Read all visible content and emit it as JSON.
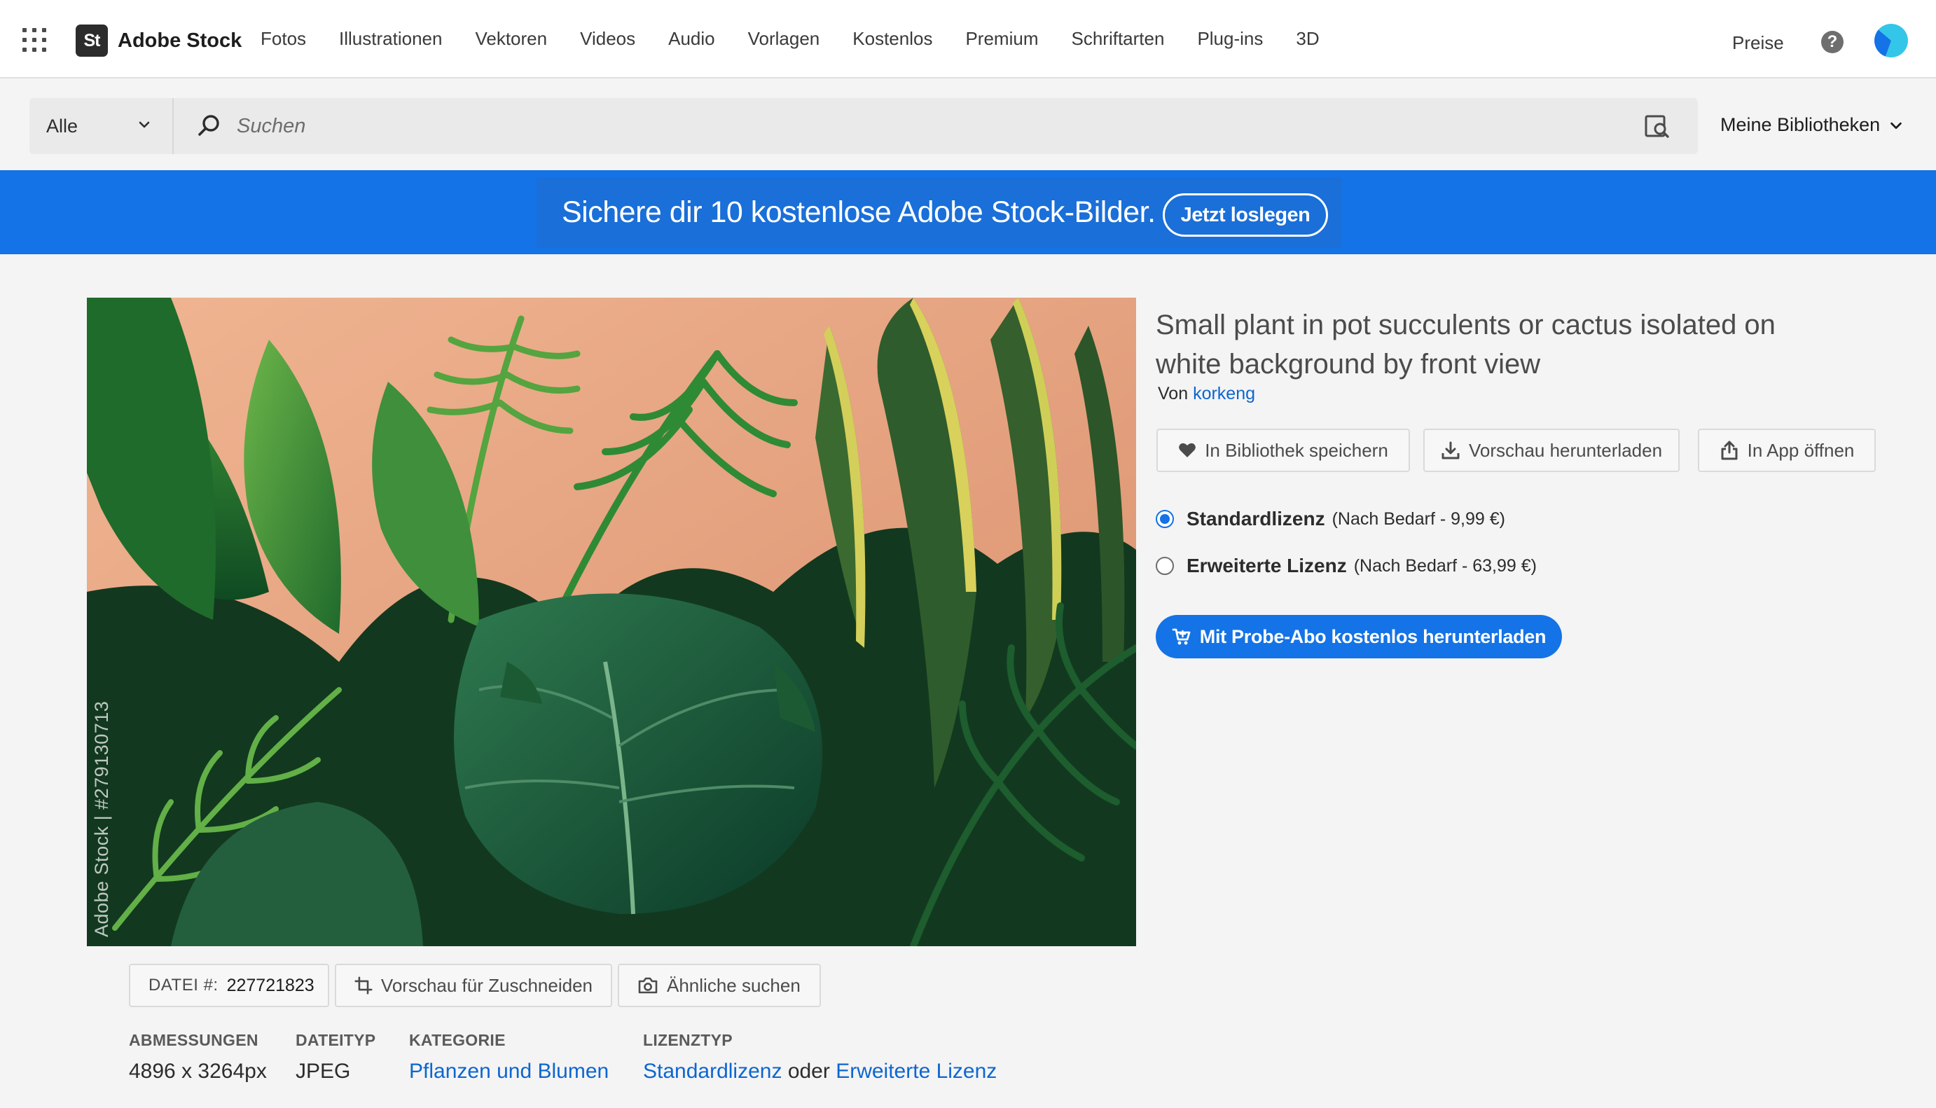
{
  "app": {
    "logo_text": "St",
    "brand_name": "Adobe Stock"
  },
  "nav": {
    "links": [
      "Fotos",
      "Illustrationen",
      "Vektoren",
      "Videos",
      "Audio",
      "Vorlagen",
      "Kostenlos",
      "Premium",
      "Schriftarten",
      "Plug-ins",
      "3D"
    ],
    "pricing": "Preise",
    "help_symbol": "?"
  },
  "search": {
    "scope": "Alle",
    "placeholder": "Suchen",
    "libraries": "Meine Bibliotheken"
  },
  "promo": {
    "text": "Sichere dir 10 kostenlose Adobe Stock-Bilder.",
    "button": "Jetzt loslegen"
  },
  "asset": {
    "watermark": "Adobe Stock | #279130713",
    "title": "Small plant in pot succulents or cactus isolated on white background by front view",
    "by_prefix": "Von",
    "author": "korkeng"
  },
  "actions": {
    "save": "In Bibliothek speichern",
    "download_preview": "Vorschau herunterladen",
    "open_in_app": "In App öffnen"
  },
  "licenses": [
    {
      "name": "Standardlizenz",
      "price": "(Nach Bedarf - 9,99 €)",
      "selected": true
    },
    {
      "name": "Erweiterte Lizenz",
      "price": "(Nach Bedarf - 63,99 €)",
      "selected": false
    }
  ],
  "cta": "Mit Probe-Abo kostenlos herunterladen",
  "tools": {
    "file_label": "DATEI #:",
    "file_number": "227721823",
    "crop_preview": "Vorschau für Zuschneiden",
    "find_similar": "Ähnliche suchen"
  },
  "meta": {
    "dimensions_label": "ABMESSUNGEN",
    "dimensions_value": "4896 x 3264px",
    "filetype_label": "DATEITYP",
    "filetype_value": "JPEG",
    "category_label": "KATEGORIE",
    "category_value": "Pflanzen und Blumen",
    "license_label": "LIZENZTYP",
    "license_standard": "Standardlizenz",
    "license_or": "oder",
    "license_extended": "Erweiterte Lizenz"
  },
  "colors": {
    "accent": "#1473e6",
    "link": "#0d66d0",
    "background": "#f4f4f4"
  }
}
